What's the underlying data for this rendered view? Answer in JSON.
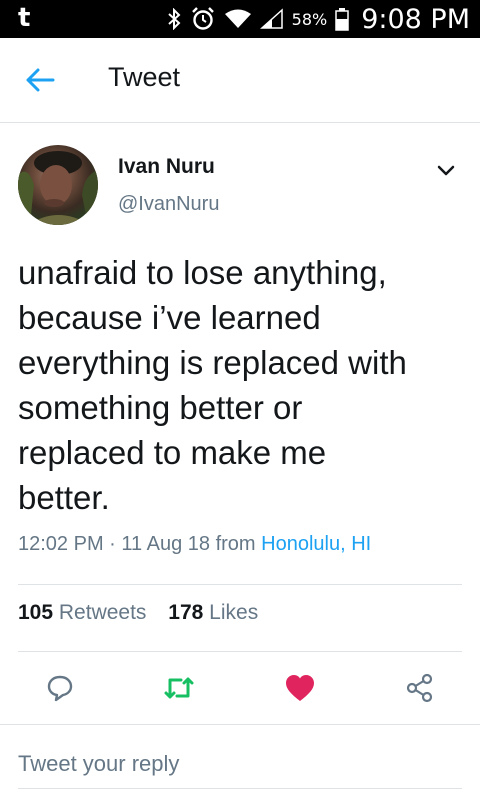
{
  "status_bar": {
    "app_icon": "t",
    "icons": [
      "bluetooth-icon",
      "alarm-icon",
      "wifi-icon",
      "signal-icon"
    ],
    "battery_percent": "58%",
    "battery_level": 0.58,
    "time": "9:08 PM"
  },
  "header": {
    "title": "Tweet",
    "back_icon": "arrow-left-icon"
  },
  "tweet": {
    "author_name": "Ivan Nuru",
    "author_handle": "@IvanNuru",
    "text": "unafraid to lose anything,\nbecause i’ve learned\neverything is replaced with\nsomething better or\nreplaced to make me\nbetter.",
    "time": "12:02 PM",
    "dot": "·",
    "date": "11 Aug 18",
    "from_label": "from",
    "location": "Honolulu, HI",
    "retweets_count": "105",
    "retweets_label": "Retweets",
    "likes_count": "178",
    "likes_label": "Likes"
  },
  "actions": {
    "reply_icon": "reply-icon",
    "retweet_icon": "retweet-icon",
    "like_icon": "heart-icon",
    "share_icon": "share-icon",
    "retweet_color": "#17bf63",
    "like_color": "#e0245e"
  },
  "reply": {
    "placeholder": "Tweet your reply"
  },
  "colors": {
    "accent": "#1da1f2",
    "secondary_text": "#657786"
  }
}
